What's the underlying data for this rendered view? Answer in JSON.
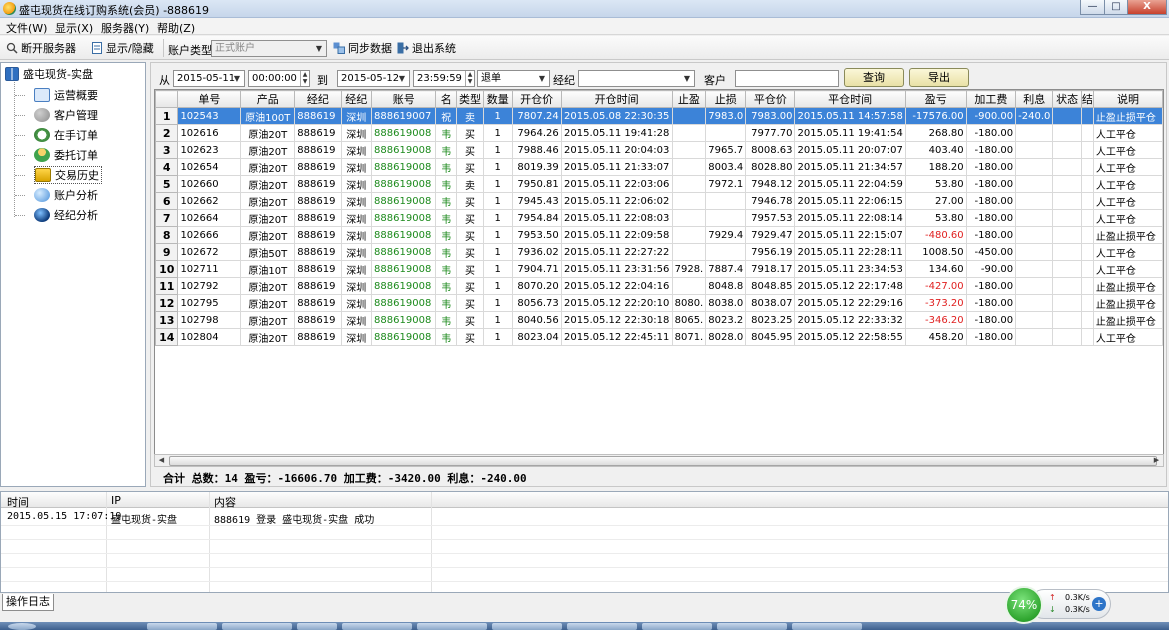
{
  "window": {
    "title": "盛屯现货在线订购系统(会员) -888619",
    "min": "—",
    "max": "□",
    "close": "X"
  },
  "menu": [
    "文件(W)",
    "显示(X)",
    "服务器(Y)",
    "帮助(Z)"
  ],
  "toolbar": {
    "disconnect": "断开服务器",
    "toggle": "显示/隐藏",
    "account_type_label": "账户类型",
    "account_type_value": "正式账户",
    "sync": "同步数据",
    "exit": "退出系统"
  },
  "tree": {
    "root": "盛屯现货-实盘",
    "items": [
      "运营概要",
      "客户管理",
      "在手订单",
      "委托订单",
      "交易历史",
      "账户分析",
      "经纪分析"
    ]
  },
  "filter": {
    "from_label": "从",
    "from_date": "2015-05-11",
    "from_time": "00:00:00",
    "to_label": "到",
    "to_date": "2015-05-12",
    "to_time": "23:59:59",
    "order_type": "退单",
    "broker_label": "经纪",
    "broker_value": "",
    "client_label": "客户",
    "client_value": "",
    "query_btn": "查询",
    "export_btn": "导出"
  },
  "table": {
    "columns": [
      "单号",
      "产品",
      "经纪",
      "经纪",
      "账号",
      "名",
      "类型",
      "数量",
      "开仓价",
      "开仓时间",
      "止盈",
      "止损",
      "平仓价",
      "平仓时间",
      "盈亏",
      "加工费",
      "利息",
      "状态",
      "结",
      "说明"
    ],
    "rows": [
      [
        "1",
        "102543",
        "原油100T",
        "888619",
        "深圳",
        "888619007",
        "祝",
        "卖",
        "1",
        "7807.24",
        "2015.05.08 22:30:35",
        "",
        "7983.0",
        "7983.00",
        "2015.05.11 14:57:58",
        "-17576.00",
        "-900.00",
        "-240.0",
        "",
        "",
        "止盈止损平仓"
      ],
      [
        "2",
        "102616",
        "原油20T",
        "888619",
        "深圳",
        "888619008",
        "韦",
        "买",
        "1",
        "7964.26",
        "2015.05.11 19:41:28",
        "",
        "",
        "7977.70",
        "2015.05.11 19:41:54",
        "268.80",
        "-180.00",
        "",
        "",
        "",
        "人工平仓"
      ],
      [
        "3",
        "102623",
        "原油20T",
        "888619",
        "深圳",
        "888619008",
        "韦",
        "买",
        "1",
        "7988.46",
        "2015.05.11 20:04:03",
        "",
        "7965.7",
        "8008.63",
        "2015.05.11 20:07:07",
        "403.40",
        "-180.00",
        "",
        "",
        "",
        "人工平仓"
      ],
      [
        "4",
        "102654",
        "原油20T",
        "888619",
        "深圳",
        "888619008",
        "韦",
        "买",
        "1",
        "8019.39",
        "2015.05.11 21:33:07",
        "",
        "8003.4",
        "8028.80",
        "2015.05.11 21:34:57",
        "188.20",
        "-180.00",
        "",
        "",
        "",
        "人工平仓"
      ],
      [
        "5",
        "102660",
        "原油20T",
        "888619",
        "深圳",
        "888619008",
        "韦",
        "卖",
        "1",
        "7950.81",
        "2015.05.11 22:03:06",
        "",
        "7972.1",
        "7948.12",
        "2015.05.11 22:04:59",
        "53.80",
        "-180.00",
        "",
        "",
        "",
        "人工平仓"
      ],
      [
        "6",
        "102662",
        "原油20T",
        "888619",
        "深圳",
        "888619008",
        "韦",
        "买",
        "1",
        "7945.43",
        "2015.05.11 22:06:02",
        "",
        "",
        "7946.78",
        "2015.05.11 22:06:15",
        "27.00",
        "-180.00",
        "",
        "",
        "",
        "人工平仓"
      ],
      [
        "7",
        "102664",
        "原油20T",
        "888619",
        "深圳",
        "888619008",
        "韦",
        "买",
        "1",
        "7954.84",
        "2015.05.11 22:08:03",
        "",
        "",
        "7957.53",
        "2015.05.11 22:08:14",
        "53.80",
        "-180.00",
        "",
        "",
        "",
        "人工平仓"
      ],
      [
        "8",
        "102666",
        "原油20T",
        "888619",
        "深圳",
        "888619008",
        "韦",
        "买",
        "1",
        "7953.50",
        "2015.05.11 22:09:58",
        "",
        "7929.4",
        "7929.47",
        "2015.05.11 22:15:07",
        "-480.60",
        "-180.00",
        "",
        "",
        "",
        "止盈止损平仓"
      ],
      [
        "9",
        "102672",
        "原油50T",
        "888619",
        "深圳",
        "888619008",
        "韦",
        "买",
        "1",
        "7936.02",
        "2015.05.11 22:27:22",
        "",
        "",
        "7956.19",
        "2015.05.11 22:28:11",
        "1008.50",
        "-450.00",
        "",
        "",
        "",
        "人工平仓"
      ],
      [
        "10",
        "102711",
        "原油10T",
        "888619",
        "深圳",
        "888619008",
        "韦",
        "买",
        "1",
        "7904.71",
        "2015.05.11 23:31:56",
        "7928.",
        "7887.4",
        "7918.17",
        "2015.05.11 23:34:53",
        "134.60",
        "-90.00",
        "",
        "",
        "",
        "人工平仓"
      ],
      [
        "11",
        "102792",
        "原油20T",
        "888619",
        "深圳",
        "888619008",
        "韦",
        "买",
        "1",
        "8070.20",
        "2015.05.12 22:04:16",
        "",
        "8048.8",
        "8048.85",
        "2015.05.12 22:17:48",
        "-427.00",
        "-180.00",
        "",
        "",
        "",
        "止盈止损平仓"
      ],
      [
        "12",
        "102795",
        "原油20T",
        "888619",
        "深圳",
        "888619008",
        "韦",
        "买",
        "1",
        "8056.73",
        "2015.05.12 22:20:10",
        "8080.",
        "8038.0",
        "8038.07",
        "2015.05.12 22:29:16",
        "-373.20",
        "-180.00",
        "",
        "",
        "",
        "止盈止损平仓"
      ],
      [
        "13",
        "102798",
        "原油20T",
        "888619",
        "深圳",
        "888619008",
        "韦",
        "买",
        "1",
        "8040.56",
        "2015.05.12 22:30:18",
        "8065.",
        "8023.2",
        "8023.25",
        "2015.05.12 22:33:32",
        "-346.20",
        "-180.00",
        "",
        "",
        "",
        "止盈止损平仓"
      ],
      [
        "14",
        "102804",
        "原油20T",
        "888619",
        "深圳",
        "888619008",
        "韦",
        "买",
        "1",
        "8023.04",
        "2015.05.12 22:45:11",
        "8071.",
        "8028.0",
        "8045.95",
        "2015.05.12 22:58:55",
        "458.20",
        "-180.00",
        "",
        "",
        "",
        "人工平仓"
      ]
    ],
    "selected_row": 0
  },
  "summary": "合计 总数：14 盈亏：-16606.70 加工费：-3420.00 利息：-240.00",
  "log": {
    "columns": [
      "时间",
      "IP",
      "内容"
    ],
    "rows": [
      [
        "2015.05.15 17:07:19",
        "盛屯现货-实盘",
        "888619 登录 盛屯现货-实盘 成功"
      ]
    ],
    "tab": "操作日志"
  },
  "net": {
    "percent": "74%",
    "up": "0.3K/s",
    "down": "0.3K/s",
    "plus": "+",
    "up_arrow": "↑",
    "down_arrow": "↓"
  },
  "colors": {
    "selection": "#3c83d8",
    "positive_account": "#1c8a1c",
    "negative": "#e02020"
  }
}
